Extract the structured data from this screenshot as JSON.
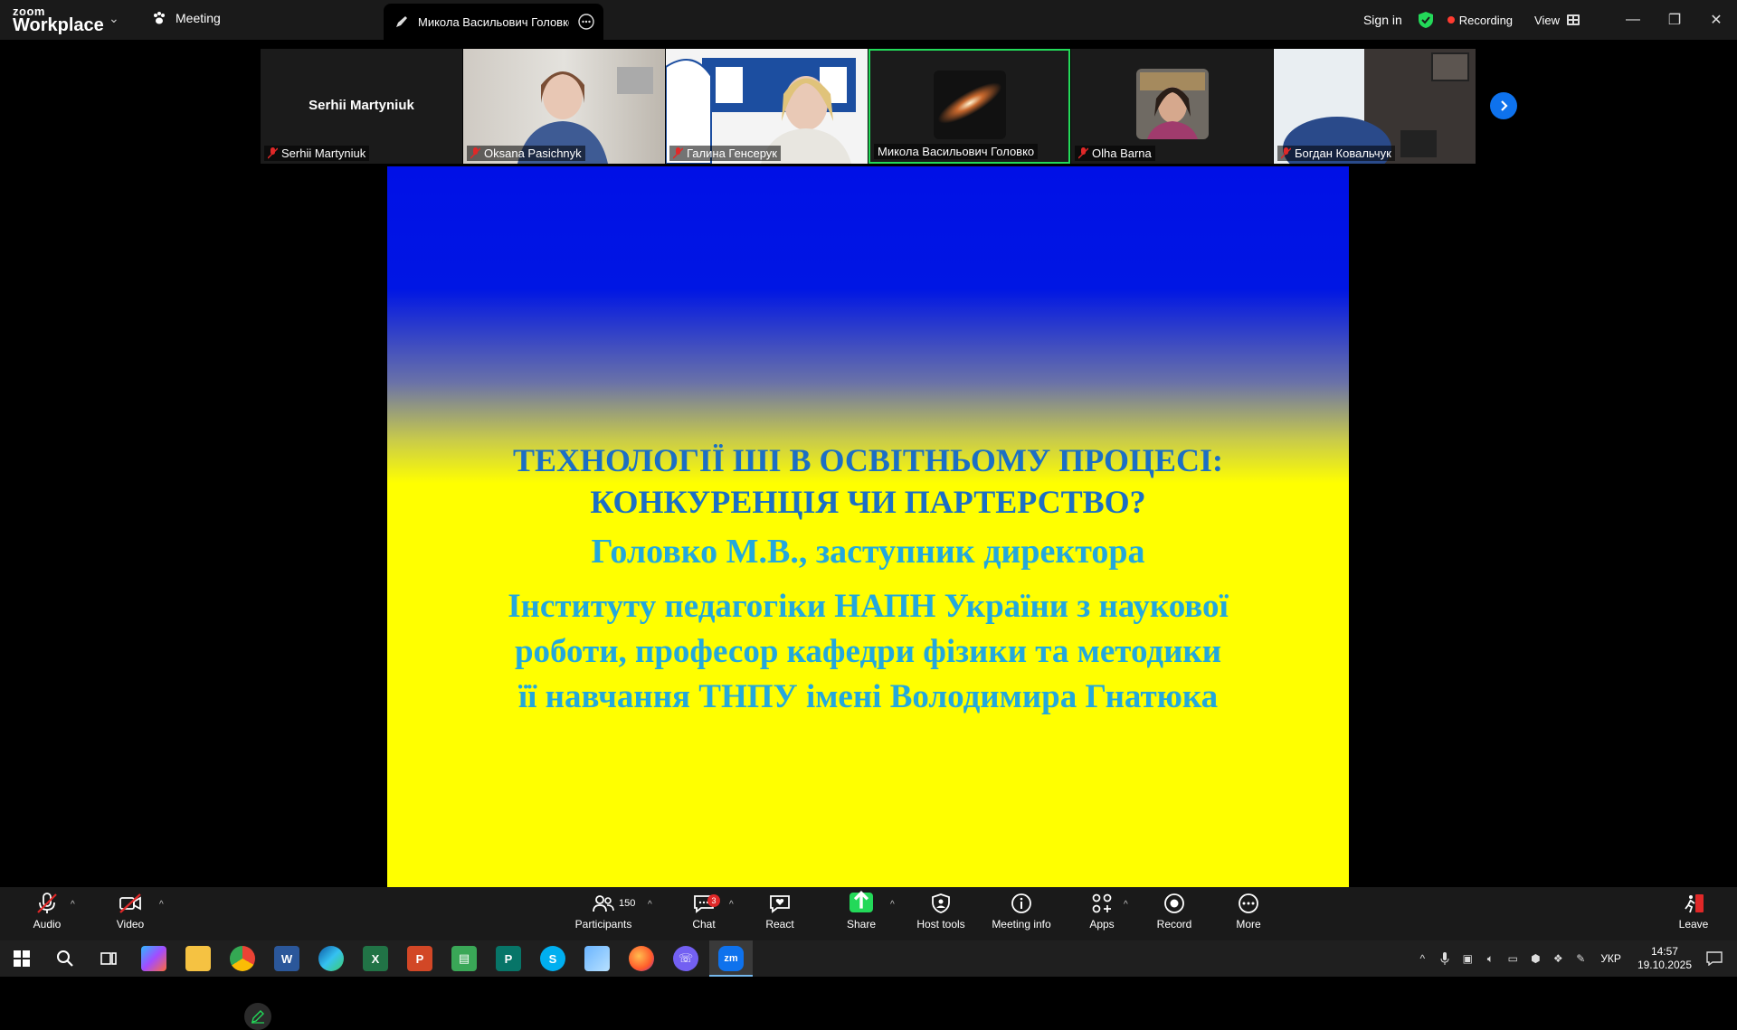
{
  "titlebar": {
    "logo_line1": "zoom",
    "logo_line2": "Workplace",
    "meeting_label": "Meeting",
    "tab_title": "Микола Васильович Головко's s",
    "sign_in": "Sign in",
    "recording": "Recording",
    "view": "View"
  },
  "participants_strip": [
    {
      "name": "Serhii Martyniuk",
      "center_name": "Serhii Martyniuk",
      "muted": true,
      "active": false
    },
    {
      "name": "Oksana Pasichnyk",
      "muted": true,
      "active": false
    },
    {
      "name": "Галина Генсерук",
      "muted": true,
      "active": false
    },
    {
      "name": "Микола Васильович Головко",
      "muted": false,
      "active": true
    },
    {
      "name": "Olha Barna",
      "muted": true,
      "active": false
    },
    {
      "name": "Богдан Ковальчук",
      "muted": true,
      "active": false
    }
  ],
  "slide": {
    "title_line1": "ТЕХНОЛОГІЇ ШІ В ОСВІТНЬОМУ ПРОЦЕСІ:",
    "title_line2": "КОНКУРЕНЦІЯ ЧИ ПАРТЕРСТВО?",
    "author": "Головко М.В., заступник директора",
    "desc_line1": "Інституту педагогіки НАПН України з наукової",
    "desc_line2": "роботи, професор кафедри фізики та методики",
    "desc_line3": "її навчання ТНПУ імені Володимира Гнатюка",
    "title_color": "#1c6fc4",
    "body_color": "#23a8dd"
  },
  "toolbar": {
    "audio": "Audio",
    "video": "Video",
    "participants": "Participants",
    "participants_count": "150",
    "chat": "Chat",
    "chat_badge": "3",
    "react": "React",
    "share": "Share",
    "host_tools": "Host tools",
    "meeting_info": "Meeting info",
    "apps": "Apps",
    "record": "Record",
    "more": "More",
    "leave": "Leave"
  },
  "taskbar": {
    "apps": [
      "windows-start",
      "search",
      "task-view",
      "copilot",
      "file-explorer",
      "chrome",
      "word",
      "edge",
      "excel",
      "powerpoint",
      "spreadsheet",
      "publisher",
      "skype",
      "photos",
      "firefox",
      "viber",
      "zoom"
    ],
    "language": "УКР",
    "time": "14:57",
    "date": "19.10.2025"
  },
  "colors": {
    "zoom_blue": "#0e72ed",
    "active_green": "#23d959",
    "record_red": "#ff3b30",
    "muted_red": "#e02828"
  }
}
